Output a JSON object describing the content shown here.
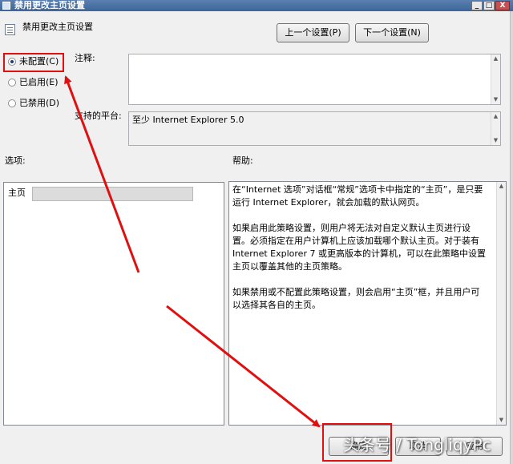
{
  "window": {
    "title": "禁用更改主页设置",
    "controls": {
      "minimize": "_",
      "maximize": "□",
      "close": "X"
    }
  },
  "header": {
    "setting_name": "禁用更改主页设置",
    "prev_button": "上一个设置(P)",
    "next_button": "下一个设置(N)"
  },
  "options": {
    "not_configured": "未配置(C)",
    "enabled": "已启用(E)",
    "disabled": "已禁用(D)",
    "selected": "not_configured"
  },
  "comment": {
    "label": "注释:",
    "value": ""
  },
  "platform": {
    "label": "支持的平台:",
    "value": "至少 Internet Explorer 5.0"
  },
  "options_section": {
    "label": "选项:",
    "homepage_label": "主页",
    "homepage_value": ""
  },
  "help": {
    "label": "帮助:",
    "paragraphs": [
      "在“Internet 选项”对话框“常规”选项卡中指定的“主页”，是只要运行 Internet Explorer，就会加载的默认网页。",
      "如果启用此策略设置，则用户将无法对自定义默认主页进行设置。必须指定在用户计算机上应该加载哪个默认主页。对于装有 Internet Explorer 7 或更高版本的计算机，可以在此策略中设置主页以覆盖其他的主页策略。",
      "如果禁用或不配置此策略设置，则会启用“主页”框，并且用户可以选择其各自的主页。"
    ]
  },
  "footer": {
    "ok_button": "确定",
    "cancel_button": "取消",
    "apply_button": "应用"
  },
  "watermark": "头条号 / TongliqyPc",
  "annotation_color": "#e01010"
}
